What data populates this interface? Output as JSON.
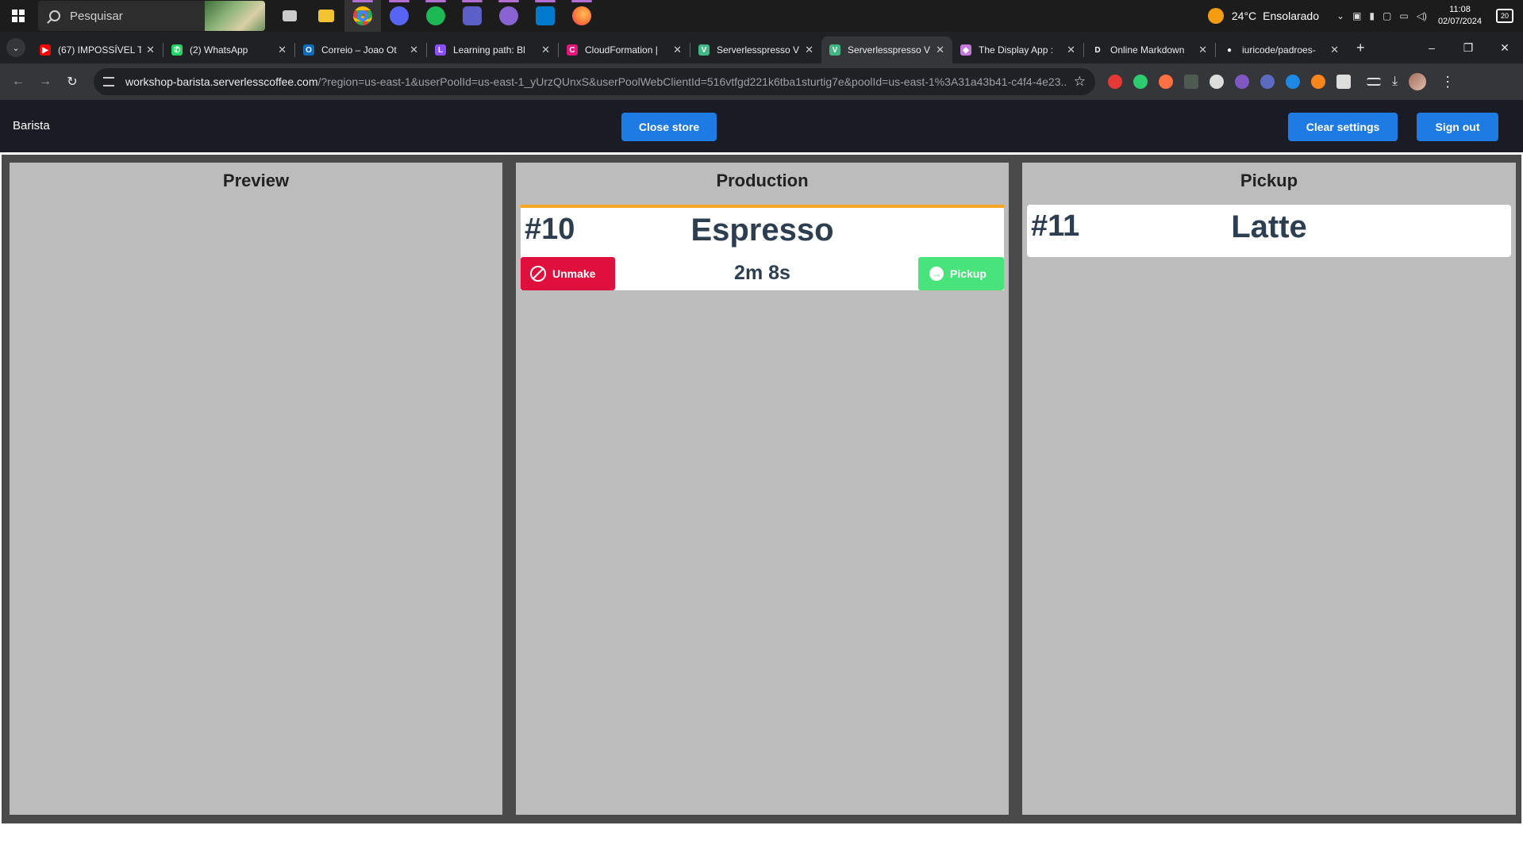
{
  "taskbar": {
    "search_placeholder": "Pesquisar",
    "apps": [
      {
        "icon": "task-view-icon",
        "color": "#cccccc"
      },
      {
        "icon": "file-explorer-icon",
        "color": "#f3c331"
      },
      {
        "icon": "chrome-icon",
        "color": "#e94235"
      },
      {
        "icon": "discord-icon",
        "color": "#5865f2"
      },
      {
        "icon": "spotify-icon",
        "color": "#1db954"
      },
      {
        "icon": "teams-icon",
        "color": "#5b5fc7"
      },
      {
        "icon": "github-icon",
        "color": "#8a63d2"
      },
      {
        "icon": "vscode-icon",
        "color": "#007acc"
      },
      {
        "icon": "firefox-icon",
        "color": "#ff7139"
      }
    ],
    "weather_temp": "24°C",
    "weather_text": "Ensolarado",
    "time": "11:08",
    "date": "02/07/2024",
    "notification_count": "20"
  },
  "browser": {
    "tabs": [
      {
        "title": "(67) IMPOSSÍVEL T",
        "icon": "youtube-icon",
        "color": "#ff0000",
        "glyph": "▶"
      },
      {
        "title": "(2) WhatsApp",
        "icon": "whatsapp-icon",
        "color": "#25d366",
        "glyph": "✆"
      },
      {
        "title": "Correio – Joao Ot",
        "icon": "outlook-icon",
        "color": "#0f6cbd",
        "glyph": "O"
      },
      {
        "title": "Learning path: Bl",
        "icon": "learning-icon",
        "color": "#8a4fff",
        "glyph": "L"
      },
      {
        "title": "CloudFormation |",
        "icon": "cloudformation-icon",
        "color": "#e7157b",
        "glyph": "C"
      },
      {
        "title": "Serverlesspresso V",
        "icon": "vue-icon",
        "color": "#41b883",
        "glyph": "V"
      },
      {
        "title": "Serverlesspresso V",
        "icon": "vue-icon",
        "color": "#41b883",
        "glyph": "V"
      },
      {
        "title": "The Display App :",
        "icon": "cube-icon",
        "color": "#c678dd",
        "glyph": "◆"
      },
      {
        "title": "Online Markdown",
        "icon": "markdown-icon",
        "color": "#202124",
        "glyph": "D"
      },
      {
        "title": "iuricode/padroes-",
        "icon": "github-icon",
        "color": "#202124",
        "glyph": "●"
      }
    ],
    "active_tab": 6,
    "url_host": "workshop-barista.serverlesscoffee.com",
    "url_rest": "/?region=us-east-1&userPoolId=us-east-1_yUrzQUnxS&userPoolWebClientId=516vtfgd221k6tba1sturtig7e&poolId=us-east-1%3A31a43b41-c4f4-4e23...",
    "extensions": [
      {
        "icon": "adblock-icon",
        "color": "#e53935"
      },
      {
        "icon": "plus-circle-icon",
        "color": "#2ecc71"
      },
      {
        "icon": "fire-icon",
        "color": "#ff7043"
      },
      {
        "icon": "screen-icon",
        "color": "#4e5a52"
      },
      {
        "icon": "eyedropper-icon",
        "color": "#dddddd"
      },
      {
        "icon": "gear-extension-icon",
        "color": "#7e57c2"
      },
      {
        "icon": "record-icon",
        "color": "#5c6bc0"
      },
      {
        "icon": "sync-icon",
        "color": "#1e88e5"
      },
      {
        "icon": "metamask-icon",
        "color": "#f6851b"
      },
      {
        "icon": "puzzle-icon",
        "color": "#dddddd"
      }
    ]
  },
  "app": {
    "brand": "Barista",
    "close_store_label": "Close store",
    "clear_settings_label": "Clear settings",
    "sign_out_label": "Sign out"
  },
  "board": {
    "columns": [
      {
        "title": "Preview",
        "orders": []
      },
      {
        "title": "Production",
        "orders": [
          {
            "number": "#10",
            "drink": "Espresso",
            "elapsed": "2m 8s",
            "unmake_label": "Unmake",
            "pickup_label": "Pickup"
          }
        ]
      },
      {
        "title": "Pickup",
        "orders": [
          {
            "number": "#11",
            "drink": "Latte"
          }
        ]
      }
    ],
    "accent_color": "#f5a623"
  }
}
